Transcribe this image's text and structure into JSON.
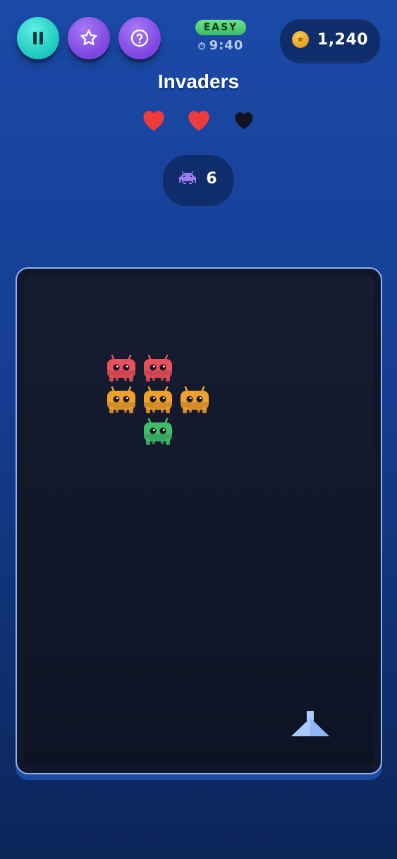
{
  "game": {
    "title": "Invaders"
  },
  "toolbar": {
    "pause_icon": "pause-icon",
    "favorite_icon": "star-icon",
    "help_icon": "question-icon"
  },
  "status": {
    "difficulty": "EASY",
    "timer": "9:40",
    "coins": "1,240"
  },
  "lives": {
    "total": 3,
    "remaining": 2
  },
  "enemies": {
    "count": "6",
    "icon": "alien-icon"
  },
  "board": {
    "rows": [
      [
        "red",
        "red"
      ],
      [
        "orange",
        "orange",
        "orange"
      ],
      [
        "green"
      ]
    ]
  },
  "colors": {
    "red": "#e8505b",
    "orange": "#f0a02c",
    "green": "#3fbd6b",
    "ship": "#a9cbff",
    "heart_full": "#ef3b3b",
    "heart_empty": "#121320"
  }
}
